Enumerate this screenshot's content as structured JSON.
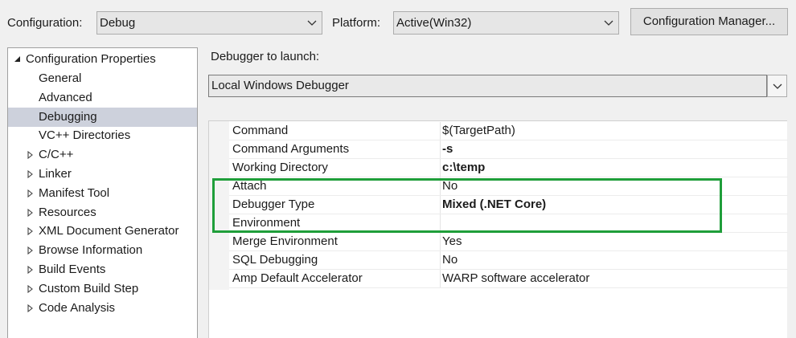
{
  "toolbar": {
    "configuration_label": "Configuration:",
    "configuration_value": "Debug",
    "platform_label": "Platform:",
    "platform_value": "Active(Win32)",
    "config_manager_button": "Configuration Manager..."
  },
  "tree": {
    "root_label": "Configuration Properties",
    "items": [
      {
        "label": "General",
        "expandable": false,
        "selected": false
      },
      {
        "label": "Advanced",
        "expandable": false,
        "selected": false
      },
      {
        "label": "Debugging",
        "expandable": false,
        "selected": true
      },
      {
        "label": "VC++ Directories",
        "expandable": false,
        "selected": false
      },
      {
        "label": "C/C++",
        "expandable": true,
        "selected": false
      },
      {
        "label": "Linker",
        "expandable": true,
        "selected": false
      },
      {
        "label": "Manifest Tool",
        "expandable": true,
        "selected": false
      },
      {
        "label": "Resources",
        "expandable": true,
        "selected": false
      },
      {
        "label": "XML Document Generator",
        "expandable": true,
        "selected": false
      },
      {
        "label": "Browse Information",
        "expandable": true,
        "selected": false
      },
      {
        "label": "Build Events",
        "expandable": true,
        "selected": false
      },
      {
        "label": "Custom Build Step",
        "expandable": true,
        "selected": false
      },
      {
        "label": "Code Analysis",
        "expandable": true,
        "selected": false
      }
    ]
  },
  "debugger": {
    "launch_label": "Debugger to launch:",
    "launch_value": "Local Windows Debugger"
  },
  "properties": [
    {
      "name": "Command",
      "value": "$(TargetPath)",
      "bold": false
    },
    {
      "name": "Command Arguments",
      "value": "-s",
      "bold": true
    },
    {
      "name": "Working Directory",
      "value": "c:\\temp",
      "bold": true
    },
    {
      "name": "Attach",
      "value": "No",
      "bold": false
    },
    {
      "name": "Debugger Type",
      "value": "Mixed (.NET Core)",
      "bold": true
    },
    {
      "name": "Environment",
      "value": "",
      "bold": false
    },
    {
      "name": "Merge Environment",
      "value": "Yes",
      "bold": false
    },
    {
      "name": "SQL Debugging",
      "value": "No",
      "bold": false
    },
    {
      "name": "Amp Default Accelerator",
      "value": "WARP software accelerator",
      "bold": false
    }
  ],
  "colors": {
    "highlight_border": "#1f9e3a",
    "selected_row": "#cdd1dc"
  }
}
